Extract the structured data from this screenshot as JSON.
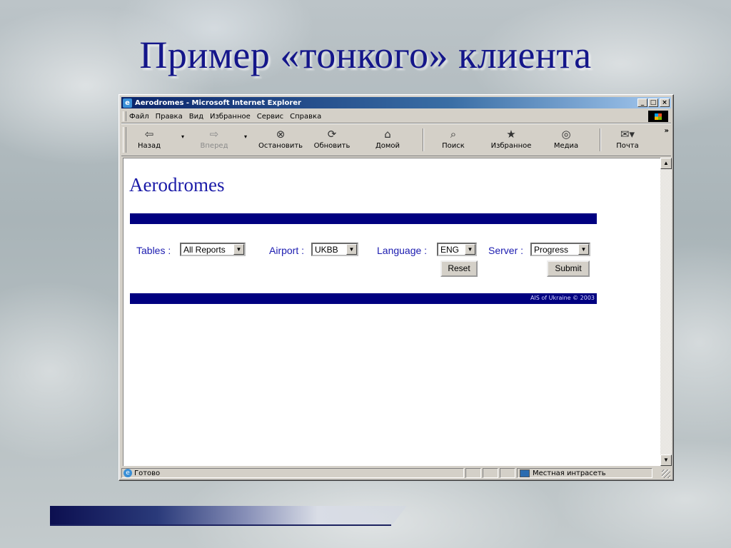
{
  "slide": {
    "title": "Пример «тонкого» клиента"
  },
  "window": {
    "title": "Aerodromes - Microsoft Internet Explorer",
    "controls": {
      "minimize": "_",
      "maximize": "□",
      "close": "×"
    }
  },
  "menu": {
    "items": [
      {
        "label": "Файл",
        "icon": ""
      },
      {
        "label": "Правка"
      },
      {
        "label": "Вид"
      },
      {
        "label": "Избранное"
      },
      {
        "label": "Сервис"
      },
      {
        "label": "Справка"
      }
    ]
  },
  "toolbar": {
    "back": {
      "label": "Назад",
      "icon": "back-arrow"
    },
    "forward": {
      "label": "Вперед",
      "icon": "forward-arrow"
    },
    "stop": {
      "label": "Остановить",
      "icon": "stop"
    },
    "refresh": {
      "label": "Обновить",
      "icon": "refresh"
    },
    "home": {
      "label": "Домой",
      "icon": "home"
    },
    "search": {
      "label": "Поиск",
      "icon": "search"
    },
    "favorites": {
      "label": "Избранное",
      "icon": "favorites"
    },
    "media": {
      "label": "Медиа",
      "icon": "media"
    },
    "mail": {
      "label": "Почта",
      "icon": "mail"
    },
    "more": "»"
  },
  "page": {
    "heading": "Aerodromes",
    "copyright": "AIS of Ukraine © 2003",
    "bar_color": "#000080",
    "form": {
      "tables": {
        "label": "Tables :",
        "value": "All Reports"
      },
      "airport": {
        "label": "Airport :",
        "value": "UKBB"
      },
      "language": {
        "label": "Language :",
        "value": "ENG"
      },
      "server": {
        "label": "Server :",
        "value": "Progress"
      },
      "reset_label": "Reset",
      "submit_label": "Submit"
    }
  },
  "status": {
    "text": "Готово",
    "zone": "Местная интрасеть"
  }
}
